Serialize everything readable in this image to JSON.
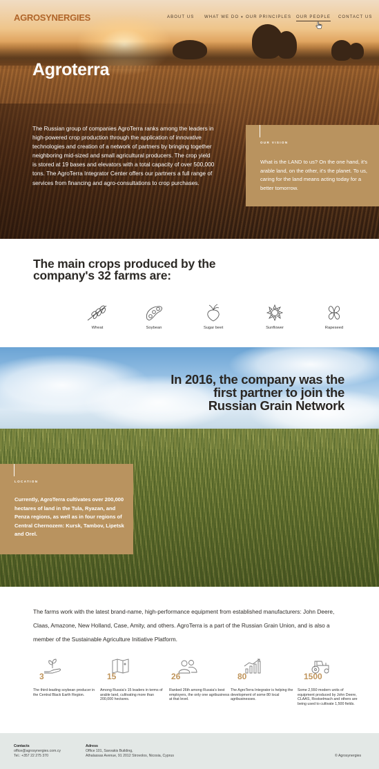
{
  "nav": {
    "logo": "AGROSYNERGIES",
    "items": [
      {
        "label": "ABOUT US"
      },
      {
        "label": "WHAT WE DO"
      },
      {
        "label": "OUR PRINCIPLES"
      },
      {
        "label": "OUR PEOPLE"
      },
      {
        "label": "CONTACT US"
      }
    ],
    "active_item": "OUR PEOPLE"
  },
  "hero": {
    "title": "Agroterra",
    "text": "The Russian group of companies AgroTerra ranks among the leaders in high-powered crop production through the application of innovative technologies and creation of a network of partners by bringing together neighboring mid-sized and small agricultural producers. The crop yield is stored at 19 bases and elevators with a total capacity of over 500,000 tons. The AgroTerra Integrator Center offers our partners a full range of services from financing and agro-consultations to crop purchases."
  },
  "vision": {
    "label": "OUR VISION",
    "text": "What is the LAND to us? On the one hand, it's arable land, on the other, it's the planet.  To us, caring for the land means acting today for a better tomorrow."
  },
  "crops": {
    "title": "The main crops produced by the company's 32 farms are:",
    "items": [
      {
        "name": "Wheat",
        "icon": "wheat-icon"
      },
      {
        "name": "Soybean",
        "icon": "soybean-icon"
      },
      {
        "name": "Sugar beet",
        "icon": "sugar-beet-icon"
      },
      {
        "name": "Sunflower",
        "icon": "sunflower-icon"
      },
      {
        "name": "Rapeseed",
        "icon": "rapeseed-icon"
      }
    ]
  },
  "grain_network": {
    "title": "In 2016, the company was the first partner to join the Russian Grain Network"
  },
  "location": {
    "label": "LOCATION",
    "text": "Currently, AgroTerra cultivates over 200,000 hectares of land in the Tula, Ryazan, and Penza regions, as well as in four regions of Central Chernozem: Kursk, Tambov, Lipetsk and Orel."
  },
  "equipment": {
    "text": "The farms work with the latest brand-name, high-performance equipment from established manufacturers: John Deere, Claas, Amazone, New Holland, Case, Amity, and others. AgroTerra is a part of the Russian Grain Union, and is also a member of the Sustainable Agriculture Initiative Platform."
  },
  "stats": [
    {
      "number": "3",
      "icon": "hand-plant-icon",
      "desc": "The third-leading soybean producer in the Central Black Earth Region."
    },
    {
      "number": "15",
      "icon": "map-icon",
      "desc": "Among Russia's 15 leaders in terms of arable land, cultivating more than 200,000 hectares."
    },
    {
      "number": "26",
      "icon": "people-icon",
      "desc": "Ranked 26th among Russia's best employers, the only one agribusiness at that level."
    },
    {
      "number": "80",
      "icon": "growth-chart-icon",
      "desc": "The AgroTerra Integrator is helping the development of some 80 local agribusinesses."
    },
    {
      "number": "1500",
      "icon": "tractor-icon",
      "desc": "Some 2,550 modern units of equipment produced by John Deere, CLAAS, Rostselmach and others are being used to cultivate 1,500 fields."
    }
  ],
  "footer": {
    "contacts_heading": "Contacts",
    "email": "office@agrosynergies.com.cy",
    "phone": "Tel.: +357 22 275 370",
    "address_heading": "Adress",
    "address_line1": "Office 101, Savvakis Building,",
    "address_line2": "Athalassas Avenue, 91 2012 Strovolos, Nicosia, Cyprus",
    "copyright": "© Agrosynergies"
  },
  "colors": {
    "accent": "#b9935f",
    "logo": "#b0652a",
    "footer_bg": "#e3e8e6"
  }
}
